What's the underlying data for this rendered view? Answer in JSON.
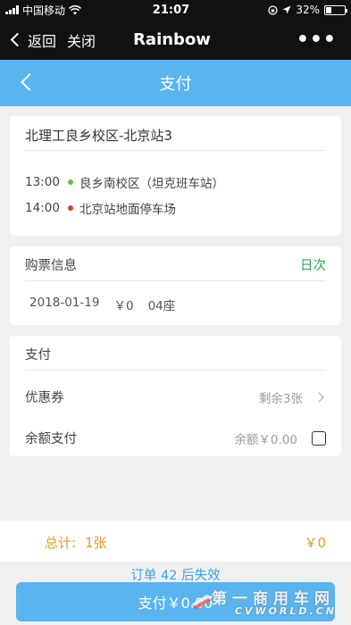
{
  "status_bar": {
    "carrier": "中国移动",
    "time": "21:07",
    "battery": "32%",
    "battery_level": 0.32
  },
  "wechat_bar": {
    "back_label": "返回",
    "close_label": "关闭",
    "title": "Rainbow",
    "more_label": "•••"
  },
  "header": {
    "title": "支付"
  },
  "route": {
    "name": "北理工良乡校区-北京站3",
    "stops": [
      {
        "time": "13:00",
        "name": "良乡南校区（坦克班车站）",
        "color": "#5cc04a"
      },
      {
        "time": "14:00",
        "name": "北京站地面停车场",
        "color": "#d9402b"
      }
    ]
  },
  "ticket": {
    "heading": "购票信息",
    "type_tag": "日次",
    "date": "2018-01-19",
    "price": "￥0",
    "seat": "04座"
  },
  "payment": {
    "heading": "支付",
    "coupon_label": "优惠券",
    "coupon_value": "剩余3张",
    "balance_label": "余额支付",
    "balance_value": "余额￥0.00",
    "balance_checked": false
  },
  "total": {
    "label": "总计:",
    "count": "1张",
    "price": "￥0"
  },
  "expire_text": "订单 42 后失效",
  "pay_button": "支付￥0.00",
  "watermark": {
    "text": "第一商用车网",
    "sub": "CVWORLD.CN"
  },
  "colors": {
    "accent": "#5ab4ef",
    "green_tag": "#29a84f",
    "total_orange": "#e69a1f",
    "expire_blue": "#3aa0e8"
  }
}
